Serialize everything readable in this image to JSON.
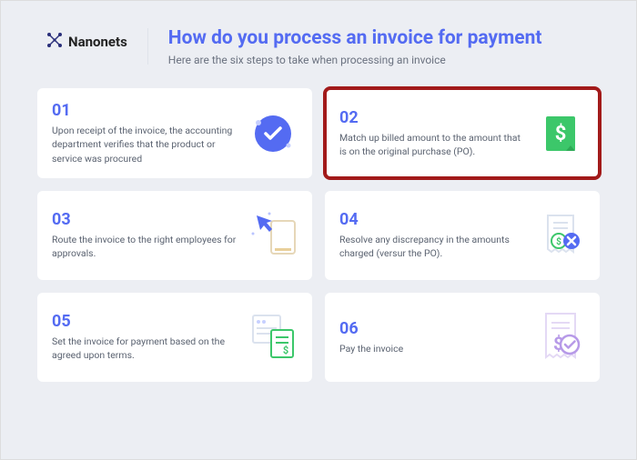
{
  "brand": "Nanonets",
  "title": "How do you process an invoice for payment",
  "subtitle": "Here are the six steps to take when processing an invoice",
  "highlighted": 1,
  "cards": [
    {
      "num": "01",
      "desc": "Upon receipt of the invoice, the accounting department verifies that the product or service was procured"
    },
    {
      "num": "02",
      "desc": "Match up billed amount to the amount that is on the original purchase (PO)."
    },
    {
      "num": "03",
      "desc": "Route the invoice to the right employees for approvals."
    },
    {
      "num": "04",
      "desc": "Resolve any discrepancy in the amounts charged (versur the PO)."
    },
    {
      "num": "05",
      "desc": "Set the invoice for payment based on the agreed upon terms."
    },
    {
      "num": "06",
      "desc": "Pay the invoice"
    }
  ]
}
